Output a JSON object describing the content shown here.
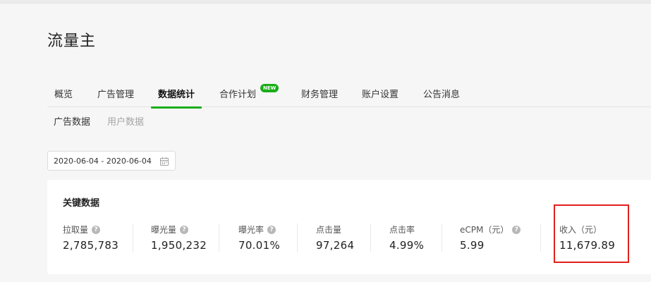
{
  "page_title": "流量主",
  "tabs": [
    {
      "label": "概览",
      "active": false
    },
    {
      "label": "广告管理",
      "active": false
    },
    {
      "label": "数据统计",
      "active": true
    },
    {
      "label": "合作计划",
      "active": false,
      "badge": "NEW"
    },
    {
      "label": "财务管理",
      "active": false
    },
    {
      "label": "账户设置",
      "active": false
    },
    {
      "label": "公告消息",
      "active": false
    }
  ],
  "subtabs": [
    {
      "label": "广告数据",
      "active": true
    },
    {
      "label": "用户数据",
      "active": false
    }
  ],
  "date_range": "2020-06-04 - 2020-06-04",
  "key_data": {
    "title": "关键数据",
    "metrics": [
      {
        "label": "拉取量",
        "value": "2,785,783",
        "help": true
      },
      {
        "label": "曝光量",
        "value": "1,950,232",
        "help": true
      },
      {
        "label": "曝光率",
        "value": "70.01%",
        "help": true
      },
      {
        "label": "点击量",
        "value": "97,264",
        "help": false
      },
      {
        "label": "点击率",
        "value": "4.99%",
        "help": false
      },
      {
        "label": "eCPM（元）",
        "value": "5.99",
        "help": true
      },
      {
        "label": "收入（元）",
        "value": "11,679.89",
        "help": false
      }
    ]
  },
  "colors": {
    "accent": "#1aad19",
    "highlight": "#e0201c"
  },
  "icons": {
    "help": "question-circle-icon",
    "calendar": "calendar-icon"
  }
}
